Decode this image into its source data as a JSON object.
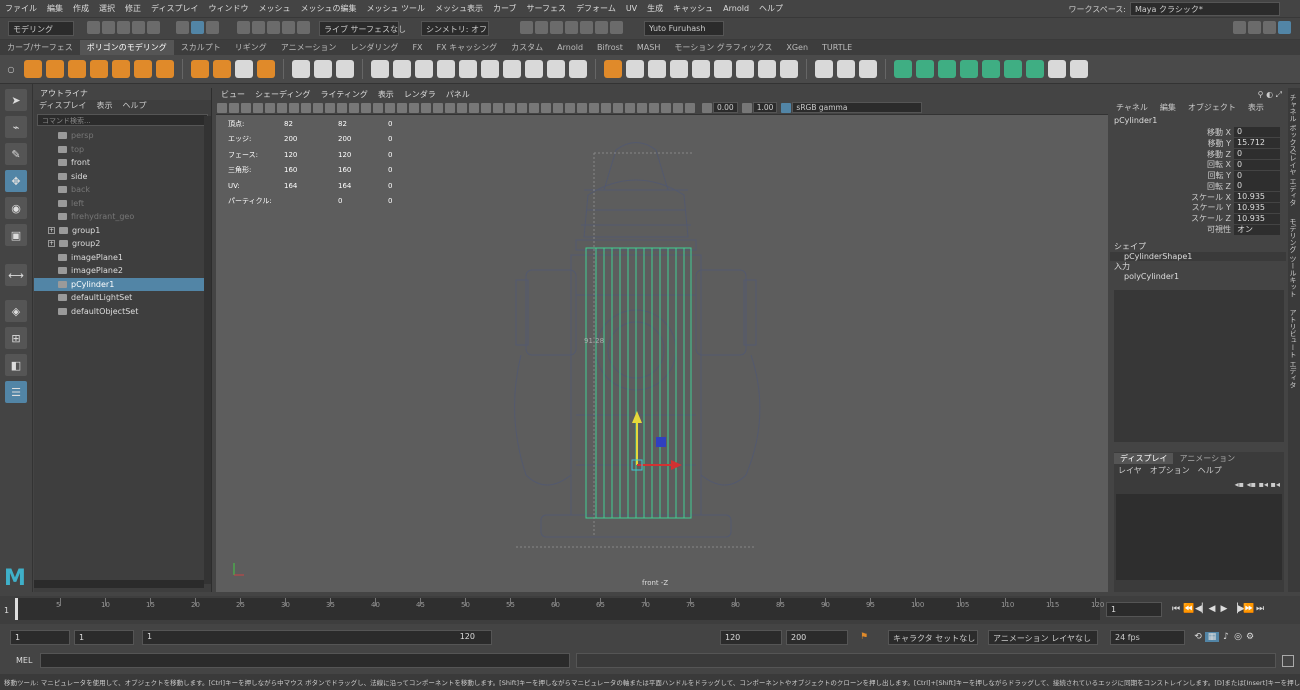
{
  "menubar": {
    "items": [
      "ファイル",
      "編集",
      "作成",
      "選択",
      "修正",
      "ディスプレイ",
      "ウィンドウ",
      "メッシュ",
      "メッシュの編集",
      "メッシュ ツール",
      "メッシュ表示",
      "カーブ",
      "サーフェス",
      "デフォーム",
      "UV",
      "生成",
      "キャッシュ",
      "Arnold",
      "ヘルプ"
    ],
    "workspace_label": "ワークスペース:",
    "workspace_value": "Maya クラシック*"
  },
  "status": {
    "mode": "モデリング",
    "surface": "ライブ サーフェスなし",
    "symmetry": "シンメトリ: オフ",
    "user": "Yuto Furuhash"
  },
  "shelf_tabs": [
    "カーブ/サーフェス",
    "ポリゴンのモデリング",
    "スカルプト",
    "リギング",
    "アニメーション",
    "レンダリング",
    "FX",
    "FX キャッシング",
    "カスタム",
    "Arnold",
    "Bifrost",
    "MASH",
    "モーション グラフィックス",
    "XGen",
    "TURTLE"
  ],
  "shelf_active": 1,
  "shelf_icons": [
    "o",
    "o",
    "o",
    "o",
    "o",
    "o",
    "o",
    "sep",
    "o",
    "o",
    "w",
    "o",
    "sep",
    "w",
    "w",
    "w",
    "sep",
    "w",
    "w",
    "w",
    "w",
    "w",
    "w",
    "w",
    "w",
    "w",
    "w",
    "sep",
    "o",
    "w",
    "w",
    "w",
    "w",
    "w",
    "w",
    "w",
    "w",
    "sep",
    "w",
    "w",
    "w",
    "sep",
    "g",
    "g",
    "g",
    "g",
    "g",
    "g",
    "g",
    "w",
    "w"
  ],
  "outliner": {
    "title": "アウトライナ",
    "menus": [
      "ディスプレイ",
      "表示",
      "ヘルプ"
    ],
    "search_placeholder": "コマンド検索...",
    "items": [
      {
        "label": "persp",
        "dim": true,
        "type": "cam"
      },
      {
        "label": "top",
        "dim": true,
        "type": "cam"
      },
      {
        "label": "front",
        "dim": false,
        "type": "cam"
      },
      {
        "label": "side",
        "dim": false,
        "type": "cam"
      },
      {
        "label": "back",
        "dim": true,
        "type": "cam"
      },
      {
        "label": "left",
        "dim": true,
        "type": "cam"
      },
      {
        "label": "firehydrant_geo",
        "dim": true,
        "type": "mesh"
      },
      {
        "label": "group1",
        "dim": false,
        "type": "group",
        "expand": "+"
      },
      {
        "label": "group2",
        "dim": false,
        "type": "group",
        "expand": "+"
      },
      {
        "label": "imagePlane1",
        "dim": false,
        "type": "img"
      },
      {
        "label": "imagePlane2",
        "dim": false,
        "type": "img"
      },
      {
        "label": "pCylinder1",
        "dim": false,
        "type": "mesh",
        "selected": true
      },
      {
        "label": "defaultLightSet",
        "dim": false,
        "type": "set"
      },
      {
        "label": "defaultObjectSet",
        "dim": false,
        "type": "set"
      }
    ]
  },
  "viewport": {
    "menus": [
      "ビュー",
      "シェーディング",
      "ライティング",
      "表示",
      "レンダラ",
      "パネル"
    ],
    "near": "0.00",
    "far": "1.00",
    "colorspace": "sRGB gamma",
    "camera_label": "front -Z",
    "measure": "91.28",
    "hud": [
      [
        "頂点:",
        "82",
        "82",
        "0"
      ],
      [
        "エッジ:",
        "200",
        "200",
        "0"
      ],
      [
        "フェース:",
        "120",
        "120",
        "0"
      ],
      [
        "三角形:",
        "160",
        "160",
        "0"
      ],
      [
        "UV:",
        "164",
        "164",
        "0"
      ],
      [
        "パーティクル:",
        "",
        "0",
        "0"
      ]
    ]
  },
  "channel_box": {
    "menus": [
      "チャネル",
      "編集",
      "オブジェクト",
      "表示"
    ],
    "object": "pCylinder1",
    "attrs": [
      [
        "移動 X",
        "0"
      ],
      [
        "移動 Y",
        "15.712"
      ],
      [
        "移動 Z",
        "0"
      ],
      [
        "回転 X",
        "0"
      ],
      [
        "回転 Y",
        "0"
      ],
      [
        "回転 Z",
        "0"
      ],
      [
        "スケール X",
        "10.935"
      ],
      [
        "スケール Y",
        "10.935"
      ],
      [
        "スケール Z",
        "10.935"
      ],
      [
        "可視性",
        "オン"
      ]
    ],
    "shapes_label": "シェイプ",
    "shape": "pCylinderShape1",
    "inputs_label": "入力",
    "input": "polyCylinder1",
    "layer_tabs": [
      "ディスプレイ",
      "アニメーション"
    ],
    "layer_menus": [
      "レイヤ",
      "オプション",
      "ヘルプ"
    ]
  },
  "side_tabs": [
    "チャネル ボックス/レイヤ エディタ",
    "モデリング ツールキット",
    "アトリビュート エディタ"
  ],
  "timeline": {
    "ticks": [
      "5",
      "10",
      "15",
      "20",
      "25",
      "30",
      "35",
      "40",
      "45",
      "50",
      "55",
      "60",
      "65",
      "70",
      "75",
      "80",
      "85",
      "90",
      "95",
      "100",
      "105",
      "110",
      "115",
      "120"
    ],
    "first": "1",
    "current": "1"
  },
  "range": {
    "start": "1",
    "start2": "1",
    "slider_start": "1",
    "slider_end": "120",
    "end": "120",
    "end2": "200",
    "charset": "キャラクタ セットなし",
    "animlayer": "アニメーション レイヤなし",
    "fps": "24 fps"
  },
  "mel": {
    "label": "MEL"
  },
  "help_line": "移動ツール: マニピュレータを使用して、オブジェクトを移動します。[Ctrl]キーを押しながら中マウス ボタンでドラッグし、法線に沿ってコンポーネントを移動します。[Shift]キーを押しながらマニピュレータの軸または平面ハンドルをドラッグして、コンポーネントやオブジェクトのクローンを押し出します。[Ctrl]+[Shift]キーを押しながらドラッグして、接続されているエッジに同期をコンストレインします。[D]または[Insert]キーを押して、ピボットの位置及び軸",
  "colors": {
    "accent": "#5285a6",
    "selection": "#44d39b",
    "orange": "#e08a2a"
  }
}
